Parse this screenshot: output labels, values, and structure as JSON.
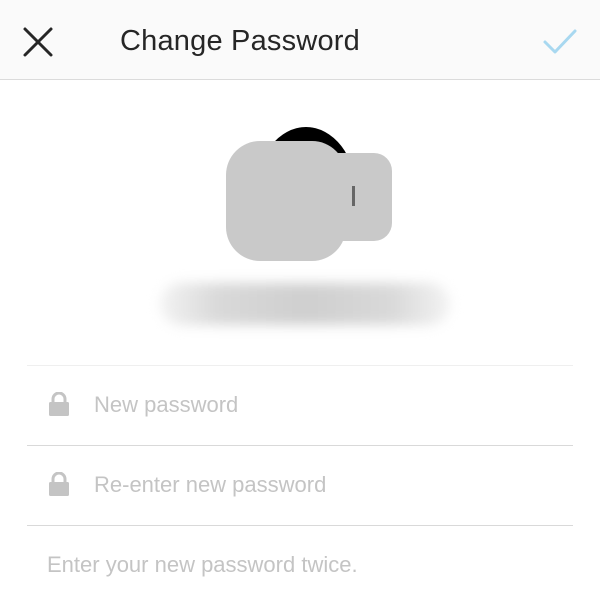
{
  "header": {
    "title": "Change Password",
    "close_icon": "close-icon",
    "confirm_icon": "checkmark-icon",
    "confirm_color": "#a8d8f0",
    "background": "#fafafa"
  },
  "profile": {
    "avatar_icon": "avatar"
  },
  "form": {
    "new_password": {
      "icon": "lock-icon",
      "value": "",
      "placeholder": "New password"
    },
    "confirm_password": {
      "icon": "lock-icon",
      "value": "",
      "placeholder": "Re-enter new password"
    },
    "hint": "Enter your new password twice."
  },
  "colors": {
    "placeholder": "#c4c4c4",
    "divider": "#d9d9d9",
    "title": "#262626"
  }
}
